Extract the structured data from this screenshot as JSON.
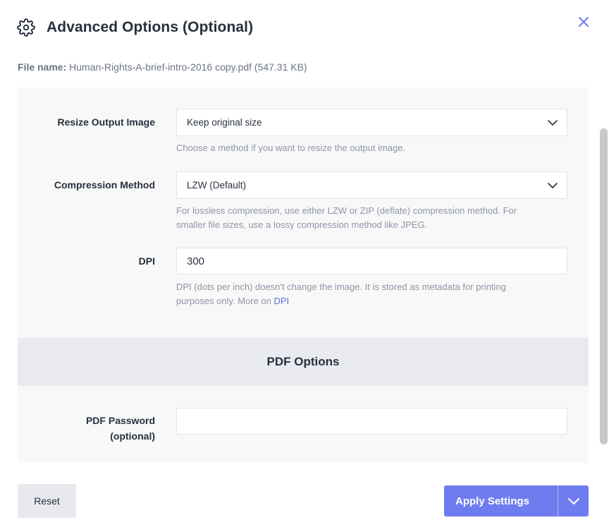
{
  "dialog": {
    "title": "Advanced Options (Optional)",
    "icon": "gear-icon",
    "close_icon": "close-icon",
    "accent_color": "#6f7cf0"
  },
  "file": {
    "label": "File name:",
    "value": "Human-Rights-A-brief-intro-2016 copy.pdf (547.31 KB)"
  },
  "resize": {
    "label": "Resize Output Image",
    "selected": "Keep original size",
    "help": "Choose a method if you want to resize the output image."
  },
  "compression": {
    "label": "Compression Method",
    "selected": "LZW (Default)",
    "help_line1": "For lossless compression, use either LZW or ZIP (deflate) compression method. For",
    "help_line2": "smaller file sizes, use a lossy compression method like JPEG."
  },
  "dpi": {
    "label": "DPI",
    "value": "300",
    "help_line1": "DPI (dots per inch) doesn't change the image. It is stored as metadata for printing",
    "help_line2_prefix": "purposes only. More on ",
    "help_link": "DPI"
  },
  "pdf_options": {
    "section_title": "PDF Options",
    "password_label_line1": "PDF Password",
    "password_label_line2": "(optional)",
    "password_value": ""
  },
  "footer": {
    "reset_label": "Reset",
    "apply_label": "Apply Settings",
    "apply_caret_icon": "chevron-down-icon"
  }
}
